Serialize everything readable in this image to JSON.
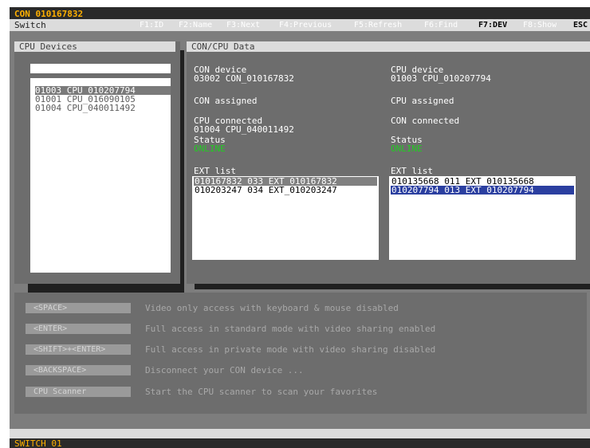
{
  "title": "CON 010167832",
  "menu": {
    "label": "Switch",
    "fkeys": [
      "F1:ID",
      "F2:Name",
      "F3:Next",
      "F4:Previous",
      "F5:Refresh",
      "F6:Find",
      "F7:DEV",
      "F8:Show",
      "ESC"
    ],
    "active": "F7:DEV"
  },
  "cpu_devices": {
    "header": "CPU Devices",
    "search": "",
    "items": [
      "01003 CPU_010207794",
      "01001 CPU_016090105",
      "01004 CPU_040011492"
    ],
    "selected_index": 0
  },
  "con_cpu": {
    "header": "CON/CPU Data",
    "con": {
      "device_label": "CON device",
      "device_value": "03002 CON_010167832",
      "assigned_label": "CON assigned",
      "connected_label": "CPU connected",
      "connected_value": "01004 CPU_040011492",
      "status_label": "Status",
      "status_value": "ONLINE",
      "ext_label": "EXT list",
      "ext": [
        "010167832 033 EXT_010167832",
        "010203247 034 EXT_010203247"
      ]
    },
    "cpu": {
      "device_label": "CPU device",
      "device_value": "01003 CPU_010207794",
      "assigned_label": "CPU assigned",
      "connected_label": "CON connected",
      "status_label": "Status",
      "status_value": "ONLINE",
      "ext_label": "EXT list",
      "ext": [
        "010135668 011 EXT_010135668",
        "010207794 013 EXT_010207794"
      ]
    }
  },
  "actions": [
    {
      "key": "<SPACE>",
      "text": "Video only access with keyboard & mouse disabled"
    },
    {
      "key": "<ENTER>",
      "text": "Full access in standard mode with video sharing enabled"
    },
    {
      "key": "<SHIFT>+<ENTER>",
      "text": "Full access in private mode with video sharing disabled"
    },
    {
      "key": "<BACKSPACE>",
      "text": "Disconnect your CON device ..."
    },
    {
      "key": "CPU Scanner",
      "text": "Start the CPU scanner to scan your favorites"
    }
  ],
  "status": "SWITCH 01"
}
